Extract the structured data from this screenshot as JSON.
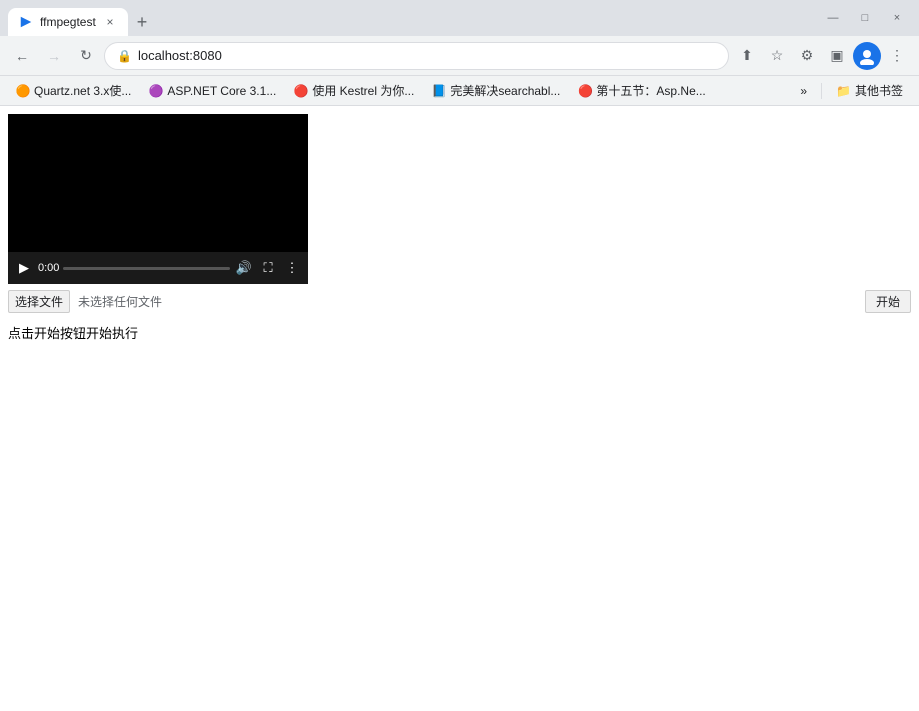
{
  "browser": {
    "title": "ffmpegtest",
    "tab": {
      "favicon": "▶",
      "title": "ffmpegtest",
      "close": "×"
    },
    "newTabLabel": "+",
    "windowControls": {
      "minimize": "—",
      "maximize": "□",
      "close": "×"
    },
    "addressBar": {
      "backDisabled": false,
      "forwardDisabled": true,
      "refreshLabel": "↻",
      "url": "localhost:8080",
      "lockIcon": "🔒"
    },
    "toolbarIcons": {
      "share": "⬆",
      "star": "☆",
      "extension": "⚙",
      "sidebar": "▣",
      "menu": "⋮"
    },
    "bookmarks": [
      {
        "id": "quartz",
        "label": "Quartz.net 3.x使...",
        "colorClass": "bm-quartz",
        "favicon": "Q"
      },
      {
        "id": "aspnet",
        "label": "ASP.NET Core 3.1...",
        "colorClass": "bm-aspnet",
        "favicon": "A"
      },
      {
        "id": "kestrel",
        "label": "使用 Kestrel 为你...",
        "colorClass": "bm-kestrel",
        "favicon": "C"
      },
      {
        "id": "simple",
        "label": "完美解决searchabl...",
        "colorClass": "bm-simple",
        "favicon": "简"
      },
      {
        "id": "searchable",
        "label": "第十五节：Asp.Ne...",
        "colorClass": "bm-searchable",
        "favicon": "C"
      }
    ],
    "bookmarksMore": "»",
    "bookmarksFolder": "其他书签"
  },
  "page": {
    "videoTime": "0:00",
    "fileChooseLabel": "选择文件",
    "noFileLabel": "未选择任何文件",
    "startLabel": "开始",
    "statusText": "点击开始按钮开始执行"
  }
}
